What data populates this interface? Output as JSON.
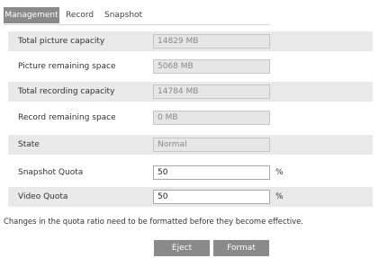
{
  "tabs": [
    {
      "label": "Management",
      "active": true
    },
    {
      "label": "Record",
      "active": false
    },
    {
      "label": "Snapshot",
      "active": false
    }
  ],
  "rows": [
    {
      "label": "Total picture capacity",
      "value": "14829 MB",
      "editable": false,
      "shaded": true
    },
    {
      "label": "Picture remaining space",
      "value": "5068 MB",
      "editable": false,
      "shaded": false
    },
    {
      "label": "Total recording capacity",
      "value": "14784 MB",
      "editable": false,
      "shaded": true
    },
    {
      "label": "Record remaining space",
      "value": "0 MB",
      "editable": false,
      "shaded": false
    },
    {
      "label": "State",
      "value": "Normal",
      "editable": false,
      "shaded": true
    },
    {
      "label": "Snapshot Quota",
      "value": "50",
      "unit": "%",
      "editable": true,
      "shaded": false
    },
    {
      "label": "Video Quota",
      "value": "50",
      "unit": "%",
      "editable": true,
      "shaded": true
    }
  ],
  "note": "Changes in the quota ratio need to be formatted before they become effective.",
  "buttons": {
    "eject": "Eject",
    "format": "Format"
  },
  "colors": {
    "accent_gray": "#8a8a8a",
    "row_shade": "#e9e9e9"
  }
}
